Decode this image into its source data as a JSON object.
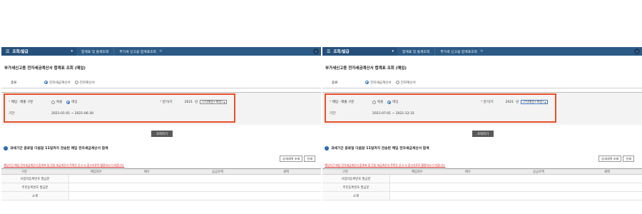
{
  "screens": [
    {
      "menu": {
        "title": "조회/발급"
      },
      "tabs": [
        "합계표 및 통계조회",
        "부가세 신고용 합계표조회"
      ],
      "page_title": "부가세신고용 전자세금계산서 합계표 조회 (매입)",
      "kind": {
        "label": "종류",
        "options": [
          "전자세금계산서",
          "전자계산서"
        ],
        "selected": 0
      },
      "filter": {
        "type_label": "매입 · 매출 구분",
        "type_options": [
          "매출",
          "매입"
        ],
        "type_selected": 1,
        "period_label": "기간",
        "term_label": "분기/기",
        "year": "2021",
        "year_unit": "년",
        "term_value": "1기(예정+확정)",
        "date_range": "2021-01-01 ~ 2021-06-30"
      },
      "search_button": "조회하기",
      "section_title": "과세기간 종료일 다음달 11일까지 전송된 매입 전자세금계산서 합계",
      "buttons": [
        "상세내역 조회",
        "인쇄"
      ],
      "notice": "해당기간 매입 전자세금계산서 합계표 및 전송 세금계산서 목록은 신고 시 참고자료로 활용하시기 바랍니다.",
      "table": {
        "headers": [
          "구분",
          "매입처수",
          "매수",
          "공급가액",
          "세액"
        ],
        "rows": [
          "사업자등록번호 발급분",
          "주민등록번호 발급분",
          "소계"
        ]
      }
    },
    {
      "menu": {
        "title": "조회/발급"
      },
      "tabs": [
        "합계표 및 통계조회",
        "부가세 신고용 합계표조회"
      ],
      "page_title": "부가세신고용 전자세금계산서 합계표 조회 (매입)",
      "kind": {
        "label": "종류",
        "options": [
          "전자세금계산서",
          "전자계산서"
        ],
        "selected": 0
      },
      "filter": {
        "type_label": "매입 · 매출 구분",
        "type_options": [
          "매출",
          "매입"
        ],
        "type_selected": 1,
        "period_label": "기간",
        "term_label": "분기/기",
        "year": "2021",
        "year_unit": "년",
        "term_value": "2기(예정+확정)",
        "date_range": "2021-07-01 ~ 2021-12-31"
      },
      "search_button": "조회하기",
      "section_title": "과세기간 종료일 다음달 11일까지 전송된 매입 전자세금계산서 합계",
      "buttons": [
        "상세내역 조회",
        "인쇄"
      ],
      "notice": "해당기간 매입 전자세금계산서 합계표 및 전송 세금계산서 목록은 신고 시 참고자료로 활용하시기 바랍니다.",
      "table": {
        "headers": [
          "구분",
          "매입처수",
          "매수",
          "공급가액",
          "세액"
        ],
        "rows": [
          "사업자등록번호 발급분",
          "주민등록번호 발급분",
          "소계"
        ]
      }
    }
  ],
  "colors": {
    "topbar": "#2c5a86",
    "highlight": "#e8502a",
    "notice": "#d32f2f",
    "accent": "#1f5fa6"
  },
  "icons": {
    "menu": "hamburger-icon",
    "caret": "caret-down-icon",
    "tab_star": "star-icon",
    "collapse": "chevron-down-icon",
    "section": "circle-arrow-icon"
  }
}
